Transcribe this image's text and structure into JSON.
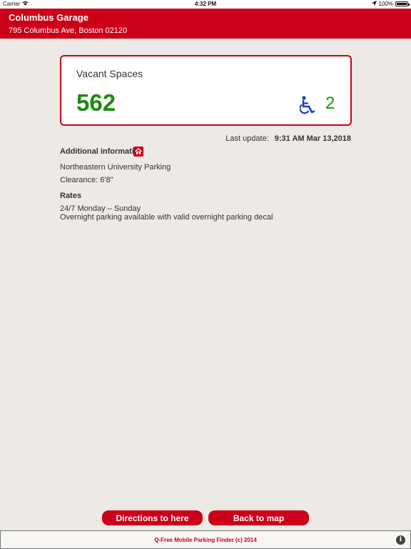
{
  "status_bar": {
    "carrier": "Carrier",
    "time": "4:32 PM",
    "battery": "100%",
    "battery_level": 1.0
  },
  "header": {
    "title": "Columbus Garage",
    "address": "795 Columbus Ave, Boston 02120",
    "color": "#cc0018"
  },
  "vacancy": {
    "label": "Vacant Spaces",
    "count": "562",
    "accessible_count": "2",
    "count_color": "#1e8a14"
  },
  "last_update": {
    "label": "Last update:",
    "value": "9:31 AM Mar 13,2018"
  },
  "additional_info": {
    "title": "Additional information",
    "lines": [
      "Northeastern University Parking",
      "Clearance: 6'8\""
    ]
  },
  "rates": {
    "title": "Rates",
    "lines": [
      "24/7 Monday – Sunday",
      "Overnight parking available with valid overnight parking decal"
    ]
  },
  "buttons": {
    "directions": "Directions to here",
    "back": "Back to map"
  },
  "footer": {
    "text": "Q-Free Mobile Parking Finder (c) 2014",
    "info_icon": "i"
  },
  "icons": [
    "wifi-icon",
    "location-arrow-icon",
    "battery-icon",
    "wheelchair-icon",
    "home-icon",
    "info-icon"
  ]
}
